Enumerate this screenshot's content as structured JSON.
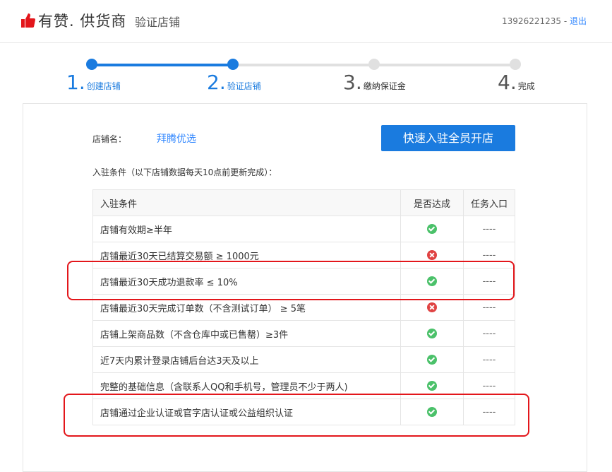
{
  "header": {
    "brand": "有赞",
    "brand_suffix": ". 供货商",
    "page_title": "验证店铺",
    "phone": "13926221235",
    "separator": " - ",
    "logout": "退出"
  },
  "steps": [
    {
      "num": "1",
      "label": "创建店铺",
      "active": true
    },
    {
      "num": "2",
      "label": "验证店铺",
      "active": true
    },
    {
      "num": "3",
      "label": "缴纳保证金",
      "active": false
    },
    {
      "num": "4",
      "label": "完成",
      "active": false
    }
  ],
  "store": {
    "label": "店铺名：",
    "name": "拜腾优选",
    "join_button": "快速入驻全员开店"
  },
  "conditions_title": "入驻条件（以下店铺数据每天10点前更新完成）：",
  "table": {
    "headers": [
      "入驻条件",
      "是否达成",
      "任务入口"
    ],
    "rows": [
      {
        "condition": "店铺有效期≥半年",
        "status": "ok",
        "entry": "----"
      },
      {
        "condition": "店铺最近30天已结算交易额 ≥ 1000元",
        "status": "fail",
        "entry": "----"
      },
      {
        "condition": "店铺最近30天成功退款率 ≤ 10%",
        "status": "ok",
        "entry": "----"
      },
      {
        "condition": "店铺最近30天完成订单数（不含测试订单） ≥ 5笔",
        "status": "fail",
        "entry": "----"
      },
      {
        "condition": "店铺上架商品数（不含仓库中或已售罄）≥3件",
        "status": "ok",
        "entry": "----"
      },
      {
        "condition": "近7天内累计登录店铺后台达3天及以上",
        "status": "ok",
        "entry": "----"
      },
      {
        "condition": "完整的基础信息（含联系人QQ和手机号，管理员不少于两人)",
        "status": "ok",
        "entry": "----"
      },
      {
        "condition": "店铺通过企业认证或官字店认证或公益组织认证",
        "status": "ok",
        "entry": "----"
      }
    ]
  },
  "colors": {
    "accent": "#1a7bdf",
    "link": "#3388ff",
    "success": "#4bc16a",
    "fail": "#e04343",
    "highlight_box": "#e3161b",
    "step_inactive": "#e0e0e0"
  }
}
